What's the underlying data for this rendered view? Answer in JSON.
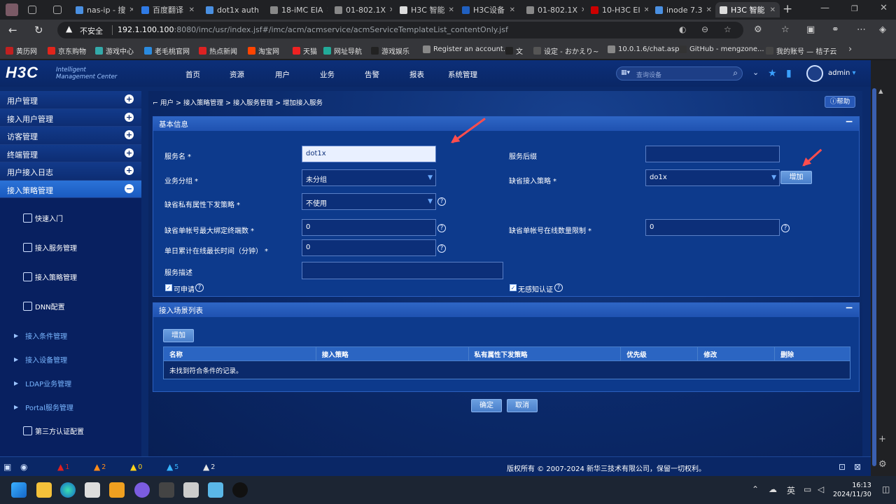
{
  "browser": {
    "tabs": [
      {
        "label": "nas-ip - 搜",
        "color": "#4a90e2"
      },
      {
        "label": "百度翻译",
        "color": "#2f7ae5"
      },
      {
        "label": "dot1x auth",
        "color": "#4a90e2"
      },
      {
        "label": "18-iMC EIA",
        "color": "#888"
      },
      {
        "label": "01-802.1X",
        "color": "#888"
      },
      {
        "label": "H3C 智能",
        "color": "#ddd"
      },
      {
        "label": "H3C设备",
        "color": "#2060c0"
      },
      {
        "label": "01-802.1X",
        "color": "#888"
      },
      {
        "label": "10-H3C EI",
        "color": "#c00"
      },
      {
        "label": "inode 7.3",
        "color": "#4a90e2"
      },
      {
        "label": "H3C 智能",
        "color": "#ddd"
      }
    ],
    "new_tab": "+",
    "insecure_label": "不安全",
    "url_host": "192.1.100.100",
    "url_rest": ":8080/imc/usr/index.jsf#/imc/acm/acmservice/acmServiceTemplateList_contentOnly.jsf",
    "bookmarks": [
      {
        "label": "黄历网",
        "color": "#c02020"
      },
      {
        "label": "京东购物",
        "color": "#e1251b"
      },
      {
        "label": "游戏中心",
        "color": "#3aa"
      },
      {
        "label": "老毛桃官网",
        "color": "#2a8be0"
      },
      {
        "label": "热点新闻",
        "color": "#d22"
      },
      {
        "label": "淘宝网",
        "color": "#f40"
      },
      {
        "label": "天猫",
        "color": "#e22"
      },
      {
        "label": "网址导航",
        "color": "#2a9"
      },
      {
        "label": "游戏娱乐",
        "color": "#222"
      },
      {
        "label": "Register an account...",
        "color": "#888"
      },
      {
        "label": "文",
        "color": "#222"
      },
      {
        "label": "设定 - おかえり~",
        "color": "#555"
      },
      {
        "label": "10.0.1.6/chat.asp",
        "color": "#888"
      },
      {
        "label": "GitHub - mengzone...",
        "color": "#333"
      },
      {
        "label": "我的账号 — 桔子云",
        "color": "#444"
      }
    ]
  },
  "app": {
    "logo": "H3C",
    "logo_sub_1": "Intelligent",
    "logo_sub_2": "Management Center",
    "nav": [
      "首页",
      "资源",
      "用户",
      "业务",
      "告警",
      "报表",
      "系统管理"
    ],
    "search_placeholder": "查询设备",
    "user": "admin",
    "help": "帮助",
    "sidebar_groups": [
      {
        "label": "用户管理",
        "open": false
      },
      {
        "label": "接入用户管理",
        "open": false
      },
      {
        "label": "访客管理",
        "open": false
      },
      {
        "label": "终端管理",
        "open": false
      },
      {
        "label": "用户接入日志",
        "open": false
      },
      {
        "label": "接入策略管理",
        "open": true
      }
    ],
    "sidebar_items": [
      {
        "label": "快速入门",
        "icon": "quickstart-icon"
      },
      {
        "label": "接入服务管理",
        "icon": "service-icon"
      },
      {
        "label": "接入策略管理",
        "icon": "policy-icon"
      },
      {
        "label": "DNN配置",
        "icon": "dnn-icon"
      }
    ],
    "sidebar_subgroups": [
      "接入条件管理",
      "接入设备管理",
      "LDAP业务管理",
      "Portal服务管理"
    ],
    "sidebar_third": "第三方认证配置",
    "breadcrumb": "用户 > 接入策略管理 > 接入服务管理 > 增加接入服务",
    "basic_panel_title": "基本信息",
    "fields": {
      "service_name_label": "服务名",
      "service_name_value": "dot1x",
      "service_suffix_label": "服务后缀",
      "service_suffix_value": "",
      "group_label": "业务分组",
      "group_value": "未分组",
      "default_policy_label": "缺省接入策略",
      "default_policy_value": "do1x",
      "add_button": "增加",
      "private_attr_label": "缺省私有属性下发策略",
      "private_attr_value": "不使用",
      "max_bind_label": "缺省单帐号最大绑定终端数",
      "max_bind_value": "0",
      "max_online_label": "缺省单帐号在线数量限制",
      "max_online_value": "0",
      "daily_online_label": "单日累计在线最长时间（分钟）",
      "daily_online_value": "0",
      "desc_label": "服务描述",
      "desc_value": "",
      "applicable_label": "可申请",
      "seamless_label": "无感知认证"
    },
    "scene_panel_title": "接入场景列表",
    "scene_add_button": "增加",
    "table_headers": [
      "名称",
      "接入策略",
      "私有属性下发策略",
      "优先级",
      "修改",
      "删除"
    ],
    "table_empty": "未找到符合条件的记录。",
    "confirm_button": "确定",
    "cancel_button": "取消",
    "alarms": [
      {
        "count": "1",
        "color": "#e02020"
      },
      {
        "count": "2",
        "color": "#ff8c1a"
      },
      {
        "count": "0",
        "color": "#ffd21a"
      },
      {
        "count": "5",
        "color": "#37b5ff"
      },
      {
        "count": "2",
        "color": "#e6e6e6"
      }
    ],
    "copyright": "版权所有 © 2007-2024 新华三技术有限公司，保留一切权利。"
  },
  "taskbar": {
    "ime": "英",
    "time": "16:13",
    "date": "2024/11/30"
  }
}
